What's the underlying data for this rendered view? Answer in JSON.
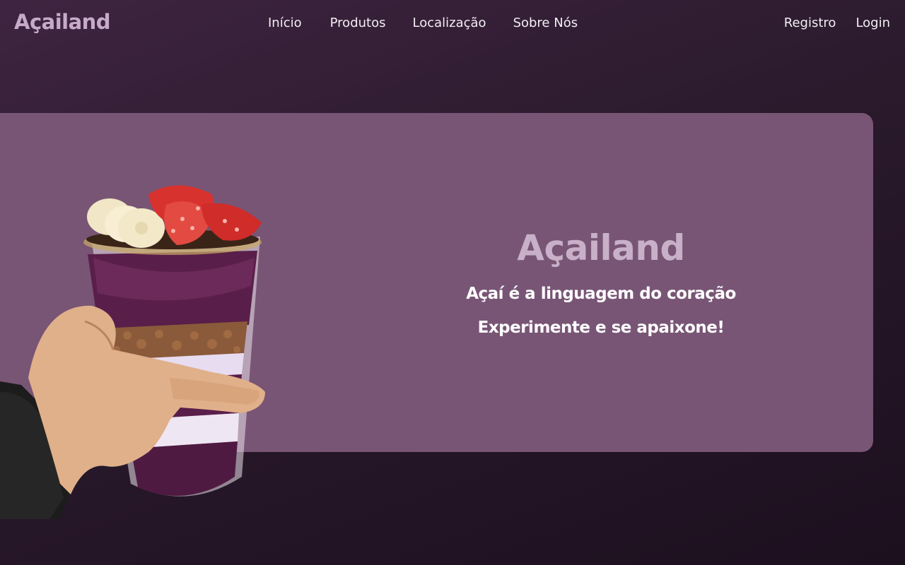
{
  "brand": {
    "name": "Açailand"
  },
  "nav": {
    "items": [
      {
        "label": "Início"
      },
      {
        "label": "Produtos"
      },
      {
        "label": "Localização"
      },
      {
        "label": "Sobre Nós"
      }
    ],
    "auth": {
      "register": "Registro",
      "login": "Login"
    }
  },
  "hero": {
    "title": "Açailand",
    "line1": "Açaí é a linguagem do coração",
    "line2": "Experimente e se apaixone!",
    "background_color": "#785575",
    "title_color": "#c9b0c9"
  },
  "image": {
    "description_icon": "acai-cup-image"
  }
}
